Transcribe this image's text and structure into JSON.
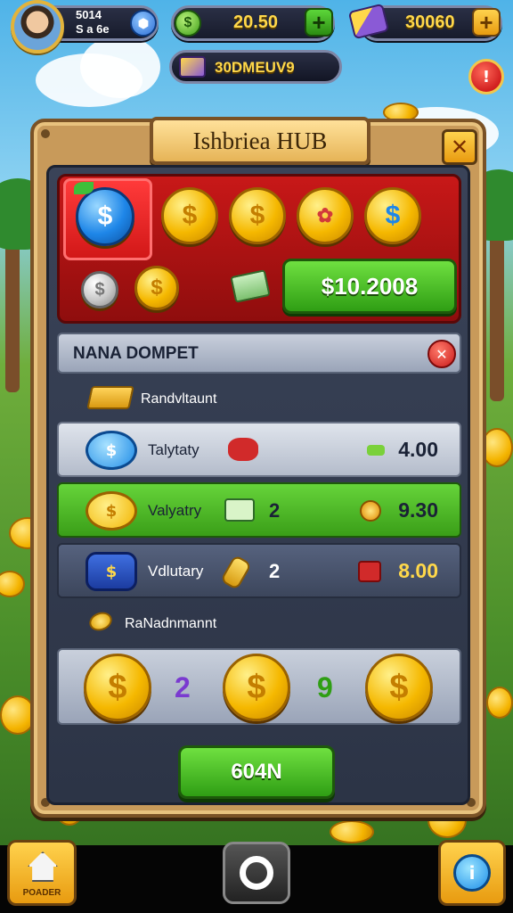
{
  "player": {
    "line1": "5014",
    "line2": "S a 6e"
  },
  "currencies": [
    {
      "value": "20.50",
      "icon": "cash-coin-icon",
      "plus": "+"
    },
    {
      "value": "30060",
      "icon": "gem-bundle-icon",
      "plus": "+"
    }
  ],
  "event": {
    "label": "30DMEUV9"
  },
  "alert_symbol": "!",
  "panel": {
    "title": "Ishbriea HUB",
    "close_symbol": "✕",
    "coin_symbol": "$",
    "price_button": "$10.2008",
    "wallet_title": "NANA DOMPET",
    "wallet_close": "✕",
    "section1_label": "Randvltaunt",
    "rows": [
      {
        "label": "Talytaty",
        "qty": "",
        "price": "4.00",
        "label_color": "#1a2236",
        "price_color": "#1a2236"
      },
      {
        "label": "Valyatry",
        "qty": "2",
        "price": "9.30",
        "label_color": "#1a2236",
        "price_color": "#1a2236"
      },
      {
        "label": "Vdlutary",
        "qty": "2",
        "price": "8.00",
        "label_color": "#ffffff",
        "price_color": "#ffd84a"
      }
    ],
    "section2_label": "RaNadnmannt",
    "rewards": [
      "2",
      "9"
    ],
    "collect_button": "604N"
  },
  "bottom": {
    "home_label": "POADER",
    "info_symbol": "i"
  },
  "colors": {
    "accent_gold": "#ffd84a",
    "green": "#2f9e14",
    "red": "#c81818"
  }
}
